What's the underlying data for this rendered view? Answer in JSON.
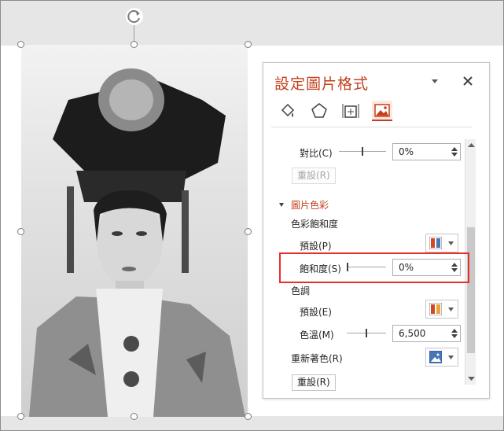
{
  "pane": {
    "title": "設定圖片格式",
    "tabs": [
      "fill-line-icon",
      "effects-icon",
      "size-properties-icon",
      "picture-icon"
    ],
    "active_tab": "picture-icon",
    "contrast": {
      "label": "對比(C)",
      "value": "0%"
    },
    "reset_top_label": "重設(R)",
    "picture_color": {
      "section_label": "圖片色彩",
      "saturation_group": "色彩飽和度",
      "saturation_preset_label": "預設(P)",
      "saturation": {
        "label": "飽和度(S)",
        "value": "0%"
      },
      "tone_group": "色調",
      "tone_preset_label": "預設(E)",
      "temperature": {
        "label": "色溫(M)",
        "value": "6,500"
      },
      "recolor_label": "重新著色(R)",
      "reset_bottom_label": "重設(R)"
    }
  },
  "colors": {
    "accent": "#c43e1c",
    "highlight": "#e8302a"
  }
}
